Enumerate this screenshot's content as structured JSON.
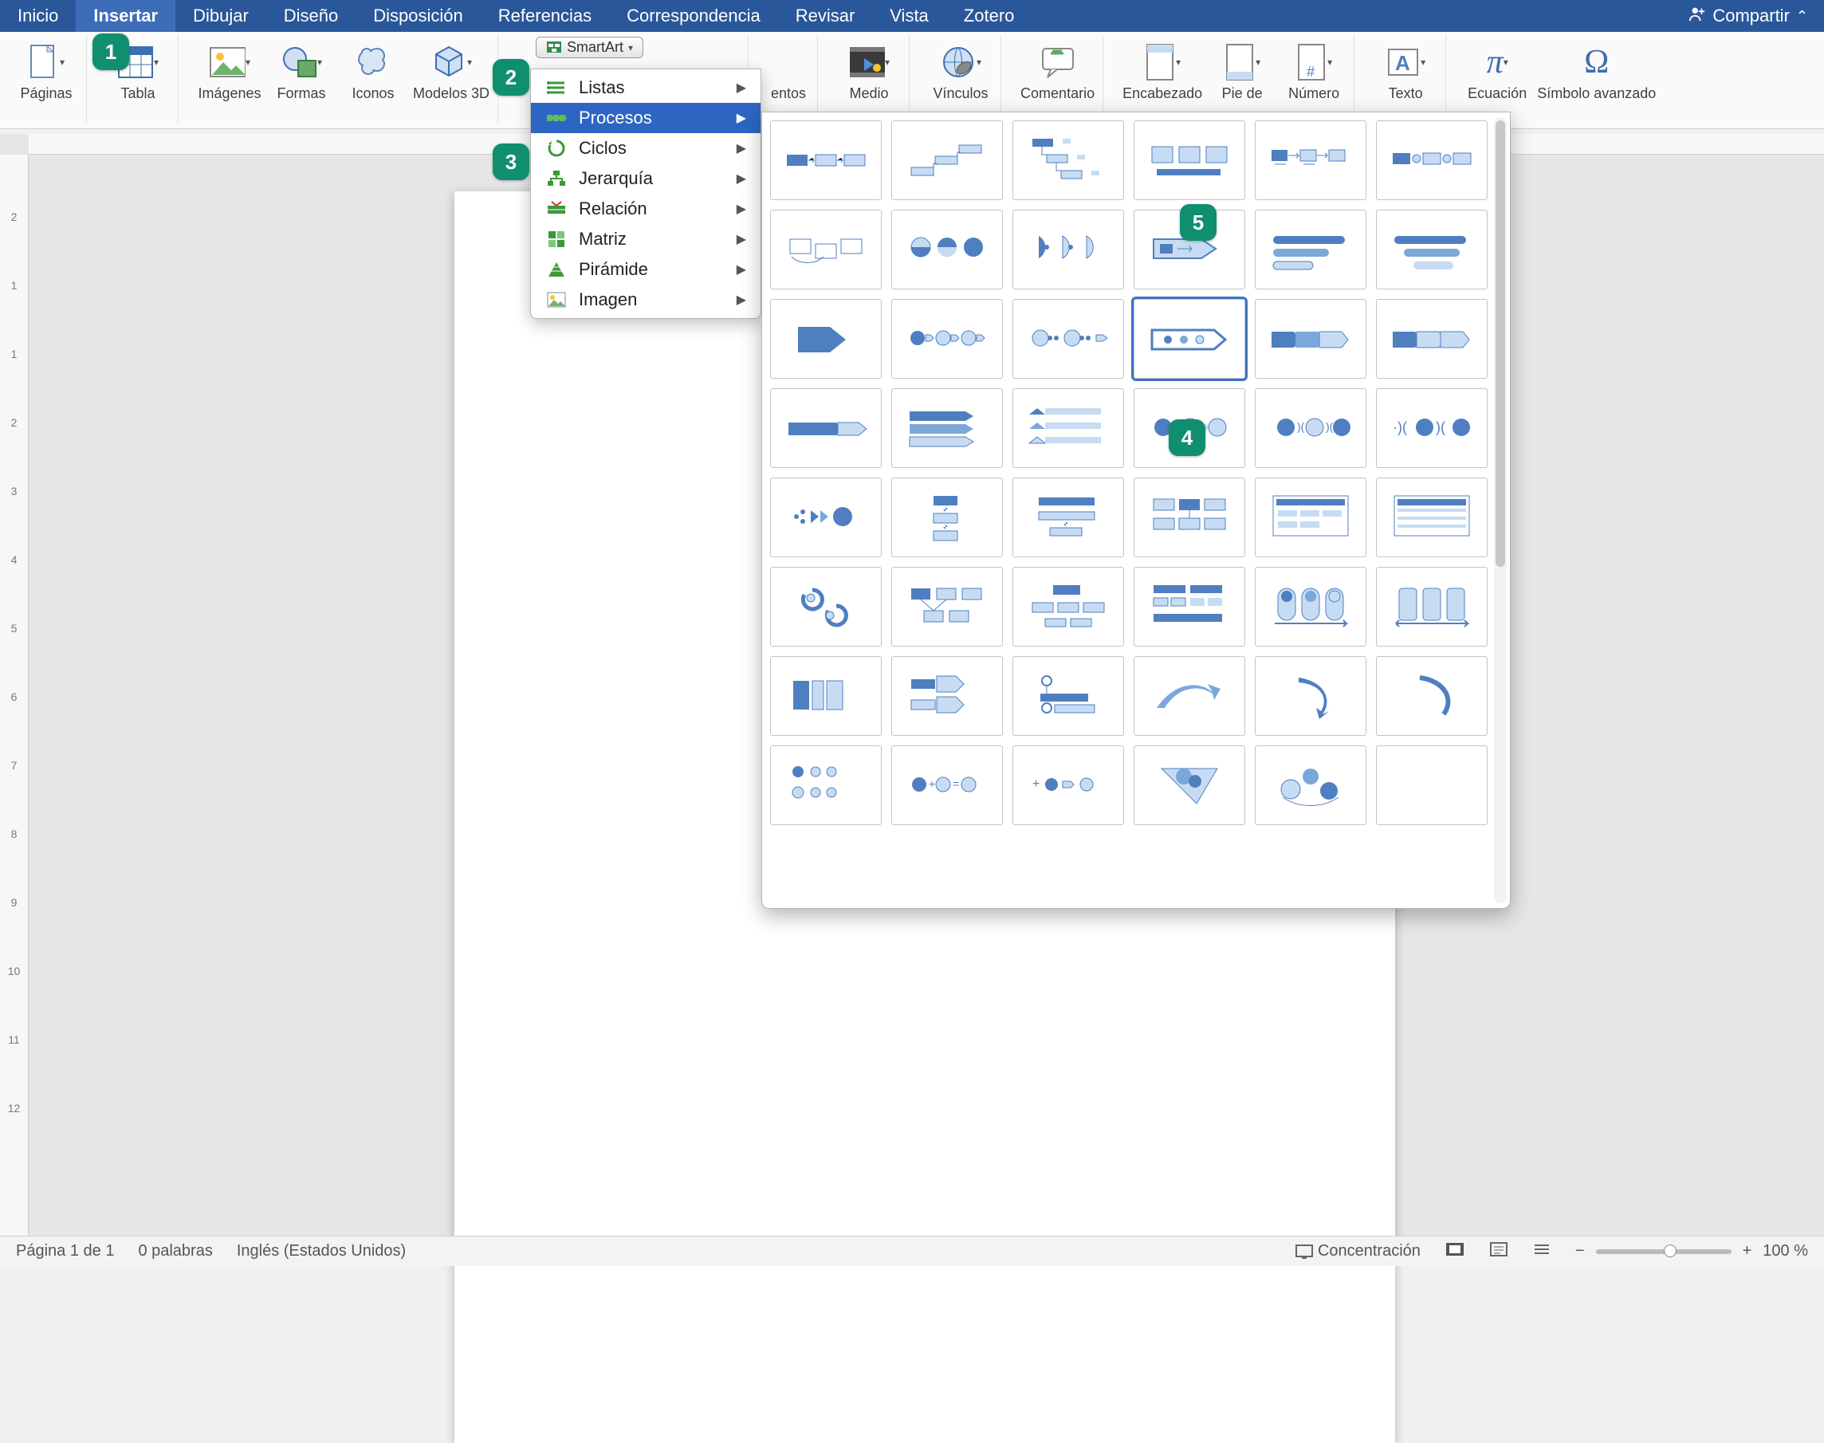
{
  "tabs": {
    "items": [
      "Inicio",
      "Insertar",
      "Dibujar",
      "Diseño",
      "Disposición",
      "Referencias",
      "Correspondencia",
      "Revisar",
      "Vista",
      "Zotero"
    ],
    "active_index": 1,
    "share_label": "Compartir"
  },
  "ribbon": {
    "paginas": "Páginas",
    "tabla": "Tabla",
    "imagenes": "Imágenes",
    "formas": "Formas",
    "iconos": "Iconos",
    "modelos3d": "Modelos 3D",
    "smartart_btn": "SmartArt",
    "medio": "Medio",
    "vinculos": "Vínculos",
    "comentario": "Comentario",
    "encabezado": "Encabezado",
    "piede": "Pie de",
    "numero": "Número",
    "texto": "Texto",
    "ecuacion": "Ecuación",
    "simbolo": "Símbolo avanzado",
    "partial_entos": "entos"
  },
  "smartart_menu": {
    "items": [
      {
        "label": "Listas",
        "icon": "list"
      },
      {
        "label": "Procesos",
        "icon": "process"
      },
      {
        "label": "Ciclos",
        "icon": "cycle"
      },
      {
        "label": "Jerarquía",
        "icon": "hierarchy"
      },
      {
        "label": "Relación",
        "icon": "relation"
      },
      {
        "label": "Matriz",
        "icon": "matrix"
      },
      {
        "label": "Pirámide",
        "icon": "pyramid"
      },
      {
        "label": "Imagen",
        "icon": "image"
      }
    ],
    "selected_index": 1
  },
  "gallery": {
    "count": 48,
    "selected_index": 15
  },
  "ruler_v_marks": [
    "2",
    "1",
    "1",
    "2",
    "3",
    "4",
    "5",
    "6",
    "7",
    "8",
    "9",
    "10",
    "11",
    "12"
  ],
  "badges": {
    "1": "1",
    "2": "2",
    "3": "3",
    "4": "4",
    "5": "5"
  },
  "statusbar": {
    "page": "Página 1 de 1",
    "words": "0 palabras",
    "lang": "Inglés (Estados Unidos)",
    "focus": "Concentración",
    "zoom": "100 %",
    "minus": "−",
    "plus": "+"
  },
  "colors": {
    "brand": "#2a579a",
    "accent": "#3d6db8",
    "badge": "#0f8f6f",
    "selection": "#3b74c6"
  }
}
